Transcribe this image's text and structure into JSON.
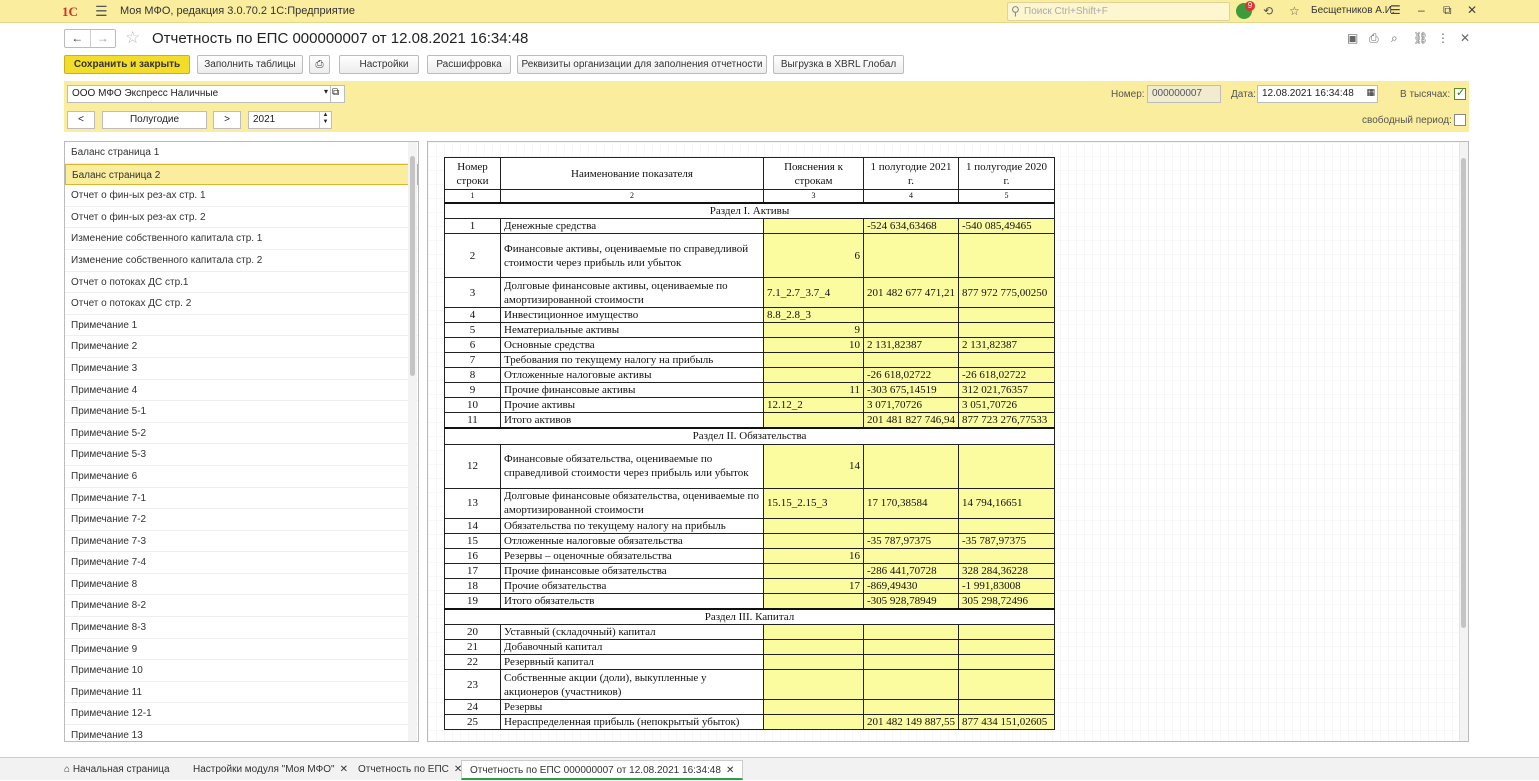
{
  "app": {
    "logo": "1С",
    "title": "Моя МФО, редакция 3.0.70.2 1С:Предприятие",
    "search_placeholder": "Поиск Ctrl+Shift+F",
    "notif_count": "9",
    "user": "Бесщетников А.И."
  },
  "doc": {
    "title": "Отчетность по ЕПС 000000007 от 12.08.2021 16:34:48"
  },
  "toolbar": {
    "save_close": "Сохранить и закрыть",
    "fill_tables": "Заполнить таблицы",
    "settings": "Настройки",
    "decode": "Расшифровка",
    "org_details": "Реквизиты организации для заполнения отчетности",
    "export_xbrl": "Выгрузка в XBRL Глобал"
  },
  "filter": {
    "org": "ООО МФО Экспресс Наличные",
    "number_label": "Номер:",
    "number": "000000007",
    "date_label": "Дата:",
    "date": "12.08.2021 16:34:48",
    "thousands_label": "В тысячах:",
    "period_prev": "<",
    "period": "Полугодие",
    "period_next": ">",
    "year": "2021",
    "free_period_label": "свободный период:"
  },
  "sidebar": [
    "Баланс страница 1",
    "Баланс страница 2",
    "Отчет о фин-ых рез-ах стр. 1",
    "Отчет о фин-ых рез-ах стр. 2",
    "Изменение собственного капитала стр. 1",
    "Изменение собственного капитала стр. 2",
    "Отчет о потоках ДС стр.1",
    "Отчет о потоках ДС стр. 2",
    "Примечание 1",
    "Примечание 2",
    "Примечание 3",
    "Примечание 4",
    "Примечание 5-1",
    "Примечание 5-2",
    "Примечание 5-3",
    "Примечание 6",
    "Примечание 7-1",
    "Примечание 7-2",
    "Примечание 7-3",
    "Примечание 7-4",
    "Примечание 8",
    "Примечание 8-2",
    "Примечание 8-3",
    "Примечание 9",
    "Примечание 10",
    "Примечание 11",
    "Примечание 12-1",
    "Примечание 13"
  ],
  "report": {
    "headers": [
      "Номер строки",
      "Наименование показателя",
      "Пояснения к строкам",
      "1 полугодие 2021 г.",
      "1 полугодие 2020 г."
    ],
    "col_nums": [
      "1",
      "2",
      "3",
      "4",
      "5"
    ],
    "rows": [
      {
        "section": "Раздел I. Активы"
      },
      {
        "n": "1",
        "name": "Денежные средства",
        "note": "",
        "v1": "-524 634,63468",
        "v2": "-540 085,49465"
      },
      {
        "n": "2",
        "name": "Финансовые активы, оцениваемые по справедливой стоимости через прибыль или убыток",
        "note": "6",
        "v1": "",
        "v2": "",
        "h": 44
      },
      {
        "n": "3",
        "name": "Долговые финансовые активы, оцениваемые по амортизированной стоимости",
        "note": "7.1_2.7_3.7_4",
        "v1": "201 482 677 471,21",
        "v2": "877 972 775,00250",
        "h": 30
      },
      {
        "n": "4",
        "name": "Инвестиционное имущество",
        "note": "8.8_2.8_3",
        "v1": "",
        "v2": ""
      },
      {
        "n": "5",
        "name": "Нематериальные активы",
        "note": "9",
        "v1": "",
        "v2": ""
      },
      {
        "n": "6",
        "name": "Основные средства",
        "note": "10",
        "v1": "2 131,82387",
        "v2": "2 131,82387"
      },
      {
        "n": "7",
        "name": "Требования по текущему налогу на прибыль",
        "note": "",
        "v1": "",
        "v2": ""
      },
      {
        "n": "8",
        "name": "Отложенные налоговые активы",
        "note": "",
        "v1": "-26 618,02722",
        "v2": "-26 618,02722"
      },
      {
        "n": "9",
        "name": "Прочие финансовые активы",
        "note": "11",
        "v1": "-303 675,14519",
        "v2": "312 021,76357"
      },
      {
        "n": "10",
        "name": "Прочие активы",
        "note": "12.12_2",
        "v1": "3 071,70726",
        "v2": "3 051,70726"
      },
      {
        "n": "11",
        "name": "Итого активов",
        "note": "",
        "v1": "201 481 827 746,94",
        "v2": "877 723 276,77533"
      },
      {
        "section": "Раздел II. Обязательства"
      },
      {
        "n": "12",
        "name": "Финансовые обязательства, оцениваемые по справедливой стоимости через прибыль или убыток",
        "note": "14",
        "v1": "",
        "v2": "",
        "h": 44
      },
      {
        "n": "13",
        "name": "Долговые финансовые обязательства, оцениваемые по амортизированной стоимости",
        "note": "15.15_2.15_3",
        "v1": "17 170,38584",
        "v2": "14 794,16651",
        "h": 30
      },
      {
        "n": "14",
        "name": "Обязательства по текущему налогу на прибыль",
        "note": "",
        "v1": "",
        "v2": ""
      },
      {
        "n": "15",
        "name": "Отложенные налоговые обязательства",
        "note": "",
        "v1": "-35 787,97375",
        "v2": "-35 787,97375"
      },
      {
        "n": "16",
        "name": "Резервы – оценочные обязательства",
        "note": "16",
        "v1": "",
        "v2": ""
      },
      {
        "n": "17",
        "name": "Прочие финансовые обязательства",
        "note": "",
        "v1": "-286 441,70728",
        "v2": "328 284,36228"
      },
      {
        "n": "18",
        "name": "Прочие обязательства",
        "note": "17",
        "v1": "-869,49430",
        "v2": "-1 991,83008"
      },
      {
        "n": "19",
        "name": "Итого обязательств",
        "note": "",
        "v1": "-305 928,78949",
        "v2": "305 298,72496"
      },
      {
        "section": "Раздел III. Капитал"
      },
      {
        "n": "20",
        "name": "Уставный (складочный) капитал",
        "note": "",
        "v1": "",
        "v2": ""
      },
      {
        "n": "21",
        "name": "Добавочный капитал",
        "note": "",
        "v1": "",
        "v2": ""
      },
      {
        "n": "22",
        "name": "Резервный капитал",
        "note": "",
        "v1": "",
        "v2": ""
      },
      {
        "n": "23",
        "name": "Собственные акции (доли), выкупленные у акционеров (участников)",
        "note": "",
        "v1": "",
        "v2": "",
        "h": 30
      },
      {
        "n": "24",
        "name": "Резервы",
        "note": "",
        "v1": "",
        "v2": ""
      },
      {
        "n": "25",
        "name": "Нераспределенная прибыль (непокрытый убыток)",
        "note": "",
        "v1": "201 482 149 887,55",
        "v2": "877 434 151,02605"
      }
    ]
  },
  "tabs": [
    {
      "label": "Начальная страница"
    },
    {
      "label": "Настройки модуля \"Моя МФО\""
    },
    {
      "label": "Отчетность по ЕПС"
    },
    {
      "label": "Отчетность по ЕПС 000000007 от 12.08.2021 16:34:48"
    }
  ]
}
